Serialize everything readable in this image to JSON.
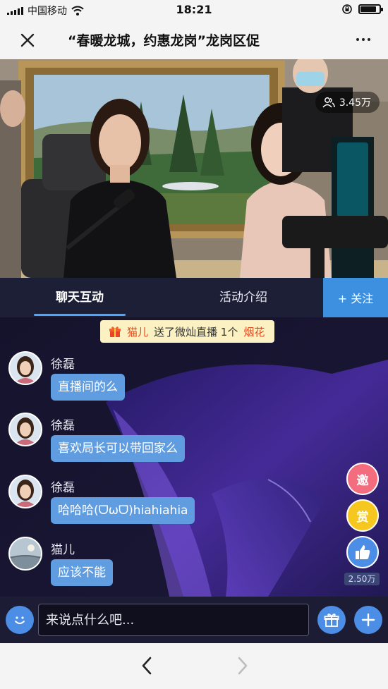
{
  "status_bar": {
    "carrier": "中国移动",
    "time": "18:21"
  },
  "title_bar": {
    "title": "“春暖龙城，约惠龙岗”龙岗区促"
  },
  "video": {
    "viewer_count": "3.45万"
  },
  "tabs": {
    "chat": "聊天互动",
    "intro": "活动介绍",
    "follow": "+ 关注"
  },
  "gift_banner": {
    "user": "猫儿",
    "text": "送了微灿直播 1个",
    "item": "烟花"
  },
  "messages": [
    {
      "name": "徐磊",
      "text": "直播间的么"
    },
    {
      "name": "徐磊",
      "text": "喜欢局长可以带回家么"
    },
    {
      "name": "徐磊",
      "text": "哈哈哈(ᗜωᗜ)hiahiahia"
    },
    {
      "name": "猫儿",
      "text": "应该不能"
    }
  ],
  "side_actions": {
    "invite": "邀",
    "reward": "赏",
    "like_count": "2.50万"
  },
  "input": {
    "placeholder": "来说点什么吧..."
  },
  "colors": {
    "accent": "#4c8ee6",
    "chat_bg": "#14132b",
    "bubble": "#5f9ce0",
    "gift_banner": "#fbf1c2"
  }
}
